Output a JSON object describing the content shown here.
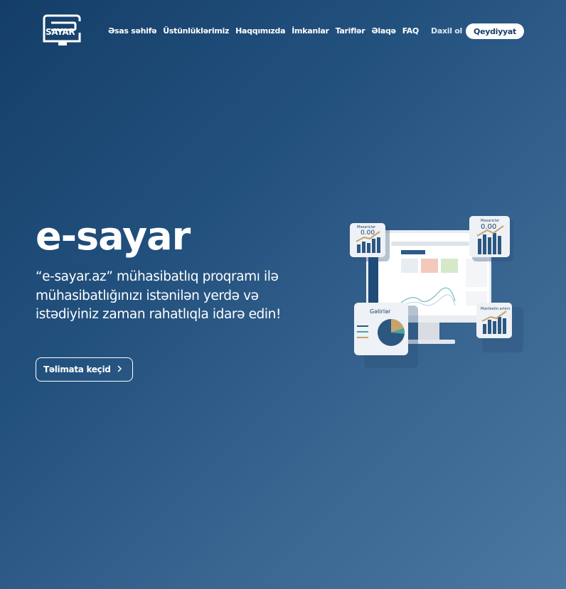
{
  "brand": {
    "logo_text": "SAYAR"
  },
  "nav": {
    "items": [
      "Əsas səhifə",
      "Üstünlüklərimiz",
      "Haqqımızda",
      "İmkanlar",
      "Tariflər",
      "Əlaqə",
      "FAQ"
    ],
    "login_label": "Daxil ol",
    "register_label": "Qeydiyyat"
  },
  "hero": {
    "title": "e-sayar",
    "description": "“e-sayar.az” mühasibatlıq proqramı ilə mühasibatlığınızı istənilən yerdə və istədiyiniz zaman rahatlıqla idarə edin!",
    "cta_label": "Təlimata keçid"
  },
  "illustration": {
    "card_top_left": {
      "title": "Məxariclər",
      "value": "0.00"
    },
    "card_top_right": {
      "title": "Məxariclər",
      "value": "0.00"
    },
    "card_income": {
      "title": "Gəlirlər"
    },
    "card_profit": {
      "title": "Mənfəətin artımı"
    }
  },
  "colors": {
    "background": "#1c4773",
    "accent_dark": "#173f68",
    "card": "#eef1f5",
    "bar": "#2c5781"
  }
}
